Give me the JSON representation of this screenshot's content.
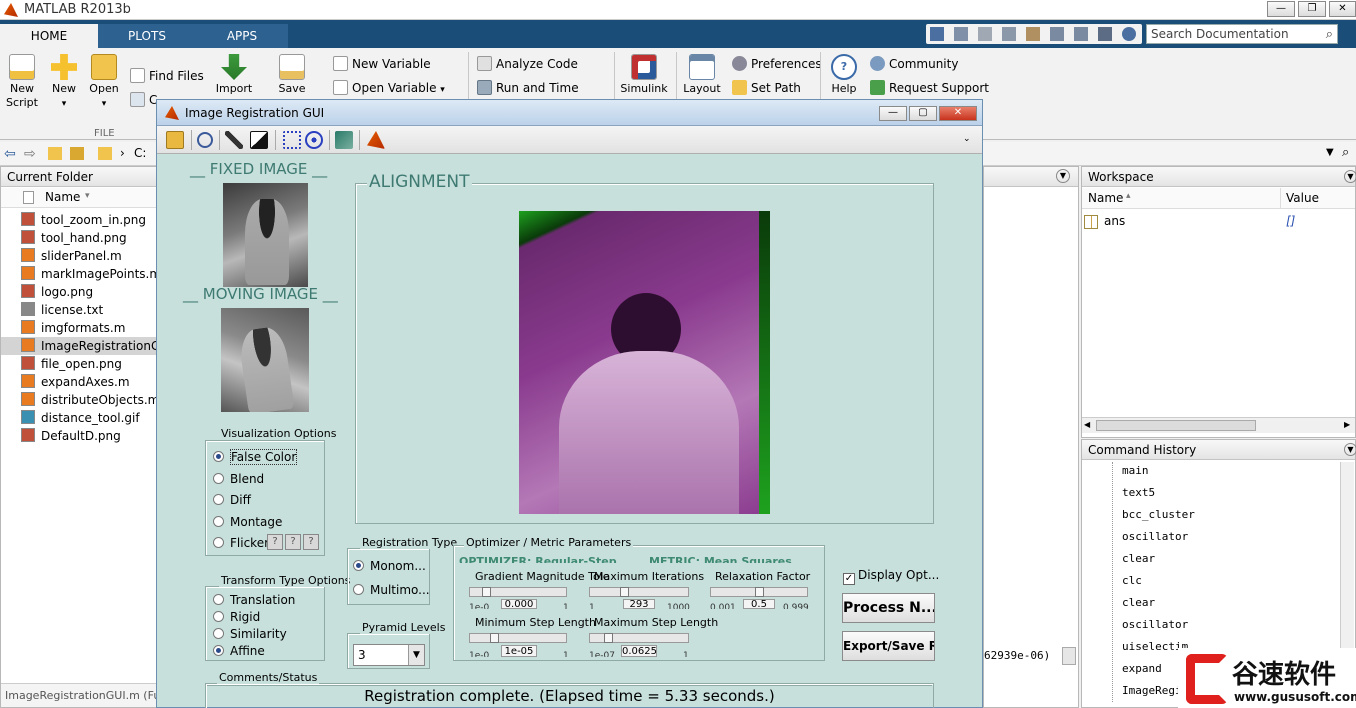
{
  "app": {
    "title": "MATLAB R2013b",
    "search_placeholder": "Search Documentation"
  },
  "tabs": [
    {
      "label": "HOME"
    },
    {
      "label": "PLOTS"
    },
    {
      "label": "APPS"
    }
  ],
  "ribbon": {
    "new_script": "New\nScript",
    "new": "New",
    "open": "Open",
    "find_files": "Find Files",
    "compare": "C",
    "import": "Import",
    "save": "Save",
    "new_variable": "New Variable",
    "open_variable": "Open Variable",
    "analyze_code": "Analyze Code",
    "run_and_time": "Run and Time",
    "simulink": "Simulink",
    "layout": "Layout",
    "preferences": "Preferences",
    "set_path": "Set Path",
    "help": "Help",
    "community": "Community",
    "request_support": "Request Support",
    "section_file": "FILE"
  },
  "address": {
    "path": "C:"
  },
  "current_folder": {
    "title": "Current Folder",
    "col_name": "Name",
    "items": [
      "tool_zoom_in.png",
      "tool_hand.png",
      "sliderPanel.m",
      "markImagePoints.m",
      "logo.png",
      "license.txt",
      "imgformats.m",
      "ImageRegistrationG",
      "file_open.png",
      "expandAxes.m",
      "distributeObjects.m",
      "distance_tool.gif",
      "DefaultD.png"
    ],
    "status": "ImageRegistrationGUI.m (Fu"
  },
  "workspace": {
    "title": "Workspace",
    "col_name": "Name",
    "col_value": "Value",
    "var_name": "ans",
    "var_value": "[]"
  },
  "command_history": {
    "title": "Command History",
    "items": [
      "main",
      "text5",
      "bcc_cluster",
      "oscillator",
      "clear",
      "clc",
      "clear",
      "oscillator",
      "uiselectim",
      "expand",
      "ImageRegistrationGUI"
    ]
  },
  "cmd_fragment": "62939e-06)",
  "gui": {
    "title": "Image Registration GUI",
    "fixed_label": "__ FIXED IMAGE __",
    "moving_label": "__ MOVING IMAGE __",
    "alignment_label": "ALIGNMENT",
    "vis_options": {
      "title": "Visualization Options",
      "items": [
        "False Color",
        "Blend",
        "Diff",
        "Montage",
        "Flicker"
      ],
      "selected": 0,
      "flicker_btns": [
        "?",
        "?",
        "?"
      ]
    },
    "transform_options": {
      "title": "Transform Type Options",
      "items": [
        "Translation",
        "Rigid",
        "Similarity",
        "Affine"
      ],
      "selected": 3
    },
    "reg_type": {
      "title": "Registration Type",
      "items": [
        "Monom...",
        "Multimo..."
      ],
      "selected": 0
    },
    "pyramid": {
      "title": "Pyramid Levels",
      "value": "3"
    },
    "optimizer": {
      "title": "Optimizer / Metric Parameters",
      "optimizer_text": "OPTIMIZER: Regular-Step",
      "metric_text": "METRIC: Mean Squares",
      "grad_label": "Gradient Magnitude Tole",
      "grad_value": "0.000",
      "grad_min": "1e-0",
      "grad_max": "1",
      "maxit_label": "Maximum Iterations",
      "maxit_value": "293",
      "maxit_min": "1",
      "maxit_max": "1000",
      "relax_label": "Relaxation Factor",
      "relax_value": "0.5",
      "relax_min": "0.001",
      "relax_max": "0.999",
      "minstep_label": "Minimum Step Length",
      "minstep_value": "1e-05",
      "minstep_min": "1e-0",
      "minstep_max": "1",
      "maxstep_label": "Maximum Step Length",
      "maxstep_value": "0.0625",
      "maxstep_min": "1e-07",
      "maxstep_max": "1"
    },
    "display_opt": "Display Opt...",
    "process_btn": "Process N...",
    "export_btn": "Export/Save R...",
    "comments_title": "Comments/Status",
    "status": "Registration complete. (Elapsed time = 5.33 seconds.)"
  },
  "watermark": {
    "brand": "谷速软件",
    "url": "www.gususoft.com"
  },
  "colors": {
    "matlab_blue": "#1b4d79",
    "gui_bg": "#c7e0dc",
    "overlay_purple": "#8a3a8e",
    "overlay_green": "#1ea21e",
    "watermark_red": "#e0201c"
  }
}
